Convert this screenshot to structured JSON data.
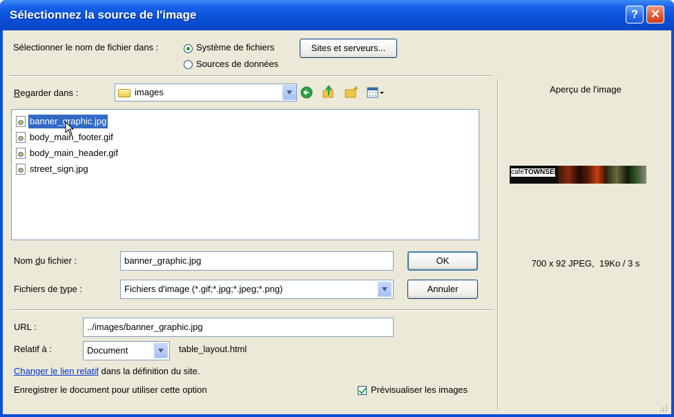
{
  "window": {
    "title": "Sélectionnez la source de l'image",
    "help_label": "?",
    "close_label": "✕"
  },
  "source": {
    "label": "Sélectionner le nom de fichier dans :",
    "option_files": "Système de fichiers",
    "option_data": "Sources de données",
    "selected": "Système de fichiers",
    "sites_button": "Sites et serveurs..."
  },
  "lookin": {
    "label_first": "R",
    "label_rest": "egarder dans :",
    "folder": "images"
  },
  "files": [
    {
      "name": "banner_graphic.jpg",
      "selected": true
    },
    {
      "name": "body_main_footer.gif",
      "selected": false
    },
    {
      "name": "body_main_header.gif",
      "selected": false
    },
    {
      "name": "street_sign.jpg",
      "selected": false
    }
  ],
  "filename": {
    "label_pre": "Nom ",
    "label_u": "d",
    "label_post": "u fichier :",
    "value": "banner_graphic.jpg",
    "ok_label": "OK"
  },
  "filetype": {
    "label_pre": "Fichiers de ",
    "label_u": "t",
    "label_post": "ype :",
    "value": "Fichiers d'image (*.gif;*.jpg;*.jpeg;*.png)",
    "cancel_label": "Annuler"
  },
  "url": {
    "label": "URL :",
    "value": "../images/banner_graphic.jpg"
  },
  "relative": {
    "label": "Relatif à :",
    "value": "Document",
    "file": "table_layout.html"
  },
  "info": {
    "link_text": "Changer le lien relatif",
    "link_suffix": " dans la définition  du site.",
    "save_note": "Enregistrer le document pour utiliser cette option",
    "preview_checkbox": "Prévisualiser les images",
    "preview_checked": true
  },
  "preview": {
    "title": "Aperçu de l'image",
    "logo_small": "café",
    "logo_big": "TOWNSEND",
    "info": "700 x 92 JPEG,  19Ko / 3 s"
  },
  "colors": {
    "titlebar": "#0a4fd8",
    "dialog_bg": "#ece9d8",
    "selection": "#316ac5",
    "link": "#0033cc"
  }
}
